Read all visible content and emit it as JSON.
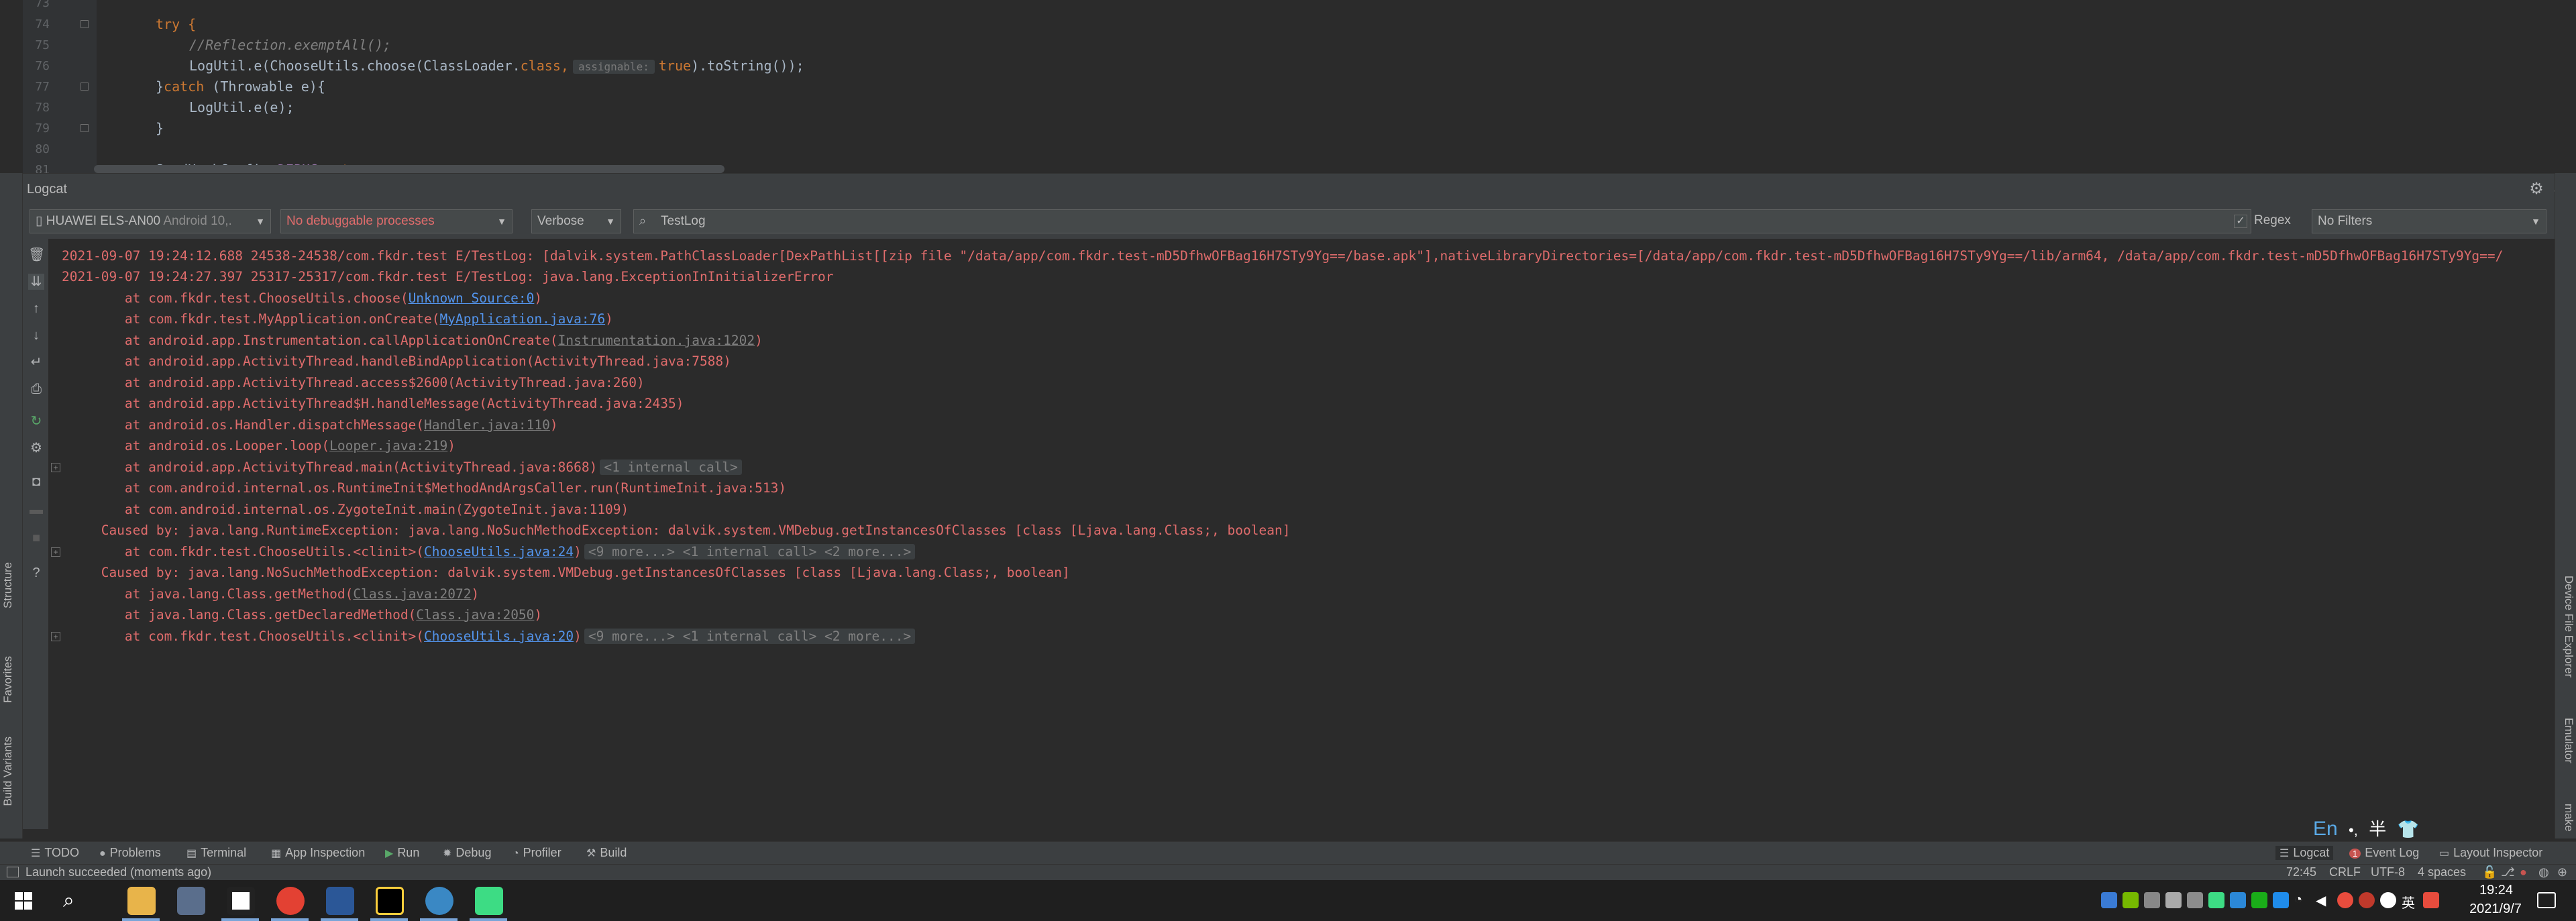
{
  "editor": {
    "line_numbers": [
      "73",
      "74",
      "75",
      "76",
      "77",
      "78",
      "79",
      "80",
      "81"
    ],
    "code": {
      "try": "try {",
      "comment": "//Reflection.exemptAll();",
      "log_call_a": "LogUtil.e(ChooseUtils.choose(ClassLoader.",
      "class_kw": "class",
      "comma": ",",
      "param_hint": "assignable:",
      "true_kw": "true",
      "log_call_b": ").toString());",
      "catch_a": "}",
      "catch_kw": "catch",
      "catch_b": " (Throwable e){",
      "log_e": "LogUtil.e(e);",
      "close": "}",
      "partial_a": "SandHookConfig.",
      "partial_field": "DEBUG",
      "partial_b": " = ",
      "partial_true": "true",
      "partial_c": ";"
    }
  },
  "logcat": {
    "title": "Logcat",
    "device": {
      "name": "HUAWEI ELS-AN00",
      "version": "Android 10,."
    },
    "process": "No debuggable processes",
    "level": "Verbose",
    "search": {
      "value": "TestLog",
      "placeholder": ""
    },
    "regex_label": "Regex",
    "regex_checked": "✓",
    "filter": "No Filters",
    "lines": [
      {
        "text": "2021-09-07 19:24:12.688 24538-24538/com.fkdr.test E/TestLog: [dalvik.system.PathClassLoader[DexPathList[[zip file \"/data/app/com.fkdr.test-mD5DfhwOFBag16H7STy9Yg==/base.apk\"],nativeLibraryDirectories=[/data/app/com.fkdr.test-mD5DfhwOFBag16H7STy9Yg==/lib/arm64, /data/app/com.fkdr.test-mD5DfhwOFBag16H7STy9Yg==/"
      },
      {
        "text": "2021-09-07 19:24:27.397 25317-25317/com.fkdr.test E/TestLog: java.lang.ExceptionInInitializerError"
      },
      {
        "pre": "        at com.fkdr.test.ChooseUtils.choose(",
        "link": "Unknown Source:0",
        "post": ")"
      },
      {
        "pre": "        at com.fkdr.test.MyApplication.onCreate(",
        "link": "MyApplication.java:76",
        "post": ")"
      },
      {
        "pre": "        at android.app.Instrumentation.callApplicationOnCreate(",
        "gray": "Instrumentation.java:1202",
        "post": ")"
      },
      {
        "text": "        at android.app.ActivityThread.handleBindApplication(ActivityThread.java:7588)"
      },
      {
        "text": "        at android.app.ActivityThread.access$2600(ActivityThread.java:260)"
      },
      {
        "text": "        at android.app.ActivityThread$H.handleMessage(ActivityThread.java:2435)"
      },
      {
        "pre": "        at android.os.Handler.dispatchMessage(",
        "gray": "Handler.java:110",
        "post": ")"
      },
      {
        "pre": "        at android.os.Looper.loop(",
        "gray": "Looper.java:219",
        "post": ")"
      },
      {
        "text": "        at android.app.ActivityThread.main(ActivityThread.java:8668)",
        "collapsed": "<1 internal call>"
      },
      {
        "text": "        at com.android.internal.os.RuntimeInit$MethodAndArgsCaller.run(RuntimeInit.java:513)"
      },
      {
        "text": "        at com.android.internal.os.ZygoteInit.main(ZygoteInit.java:1109)"
      },
      {
        "text": "     Caused by: java.lang.RuntimeException: java.lang.NoSuchMethodException: dalvik.system.VMDebug.getInstancesOfClasses [class [Ljava.lang.Class;, boolean]"
      },
      {
        "pre": "        at com.fkdr.test.ChooseUtils.<clinit>(",
        "link": "ChooseUtils.java:24",
        "post": ")",
        "collapsed": "<9 more...> <1 internal call> <2 more...>"
      },
      {
        "text": "     Caused by: java.lang.NoSuchMethodException: dalvik.system.VMDebug.getInstancesOfClasses [class [Ljava.lang.Class;, boolean]"
      },
      {
        "pre": "        at java.lang.Class.getMethod(",
        "gray": "Class.java:2072",
        "post": ")"
      },
      {
        "pre": "        at java.lang.Class.getDeclaredMethod(",
        "gray": "Class.java:2050",
        "post": ")"
      },
      {
        "pre": "        at com.fkdr.test.ChooseUtils.<clinit>(",
        "link": "ChooseUtils.java:20",
        "post": ")",
        "collapsed": "<9 more...> <1 internal call> <2 more...>"
      }
    ]
  },
  "left_tabs": {
    "structure": "Structure",
    "favorites": "Favorites",
    "build_variants": "Build Variants"
  },
  "right_tabs": {
    "device_file_explorer": "Device File Explorer",
    "emulator": "Emulator",
    "make": "make"
  },
  "ime": {
    "lang": "En",
    "punct": "•,",
    "width": "半",
    "skin": "👕"
  },
  "bottom_tabs": {
    "todo": "TODO",
    "problems": "Problems",
    "terminal": "Terminal",
    "app_inspection": "App Inspection",
    "run": "Run",
    "debug": "Debug",
    "profiler": "Profiler",
    "build": "Build",
    "logcat": "Logcat",
    "event_log": "Event Log",
    "layout_inspector": "Layout Inspector",
    "event_log_badge": "1"
  },
  "status": {
    "message": "Launch succeeded (moments ago)",
    "position": "72:45",
    "line_sep": "CRLF",
    "encoding": "UTF-8",
    "indent": "4 spaces"
  },
  "taskbar": {
    "time": "19:24",
    "date": "2021/9/7",
    "tray_lang": "英"
  },
  "colors": {
    "log_error": "#e06c6c",
    "link": "#5394ec",
    "keyword": "#cc7832",
    "panel_bg": "#3c3f41",
    "editor_bg": "#2b2b2b"
  }
}
